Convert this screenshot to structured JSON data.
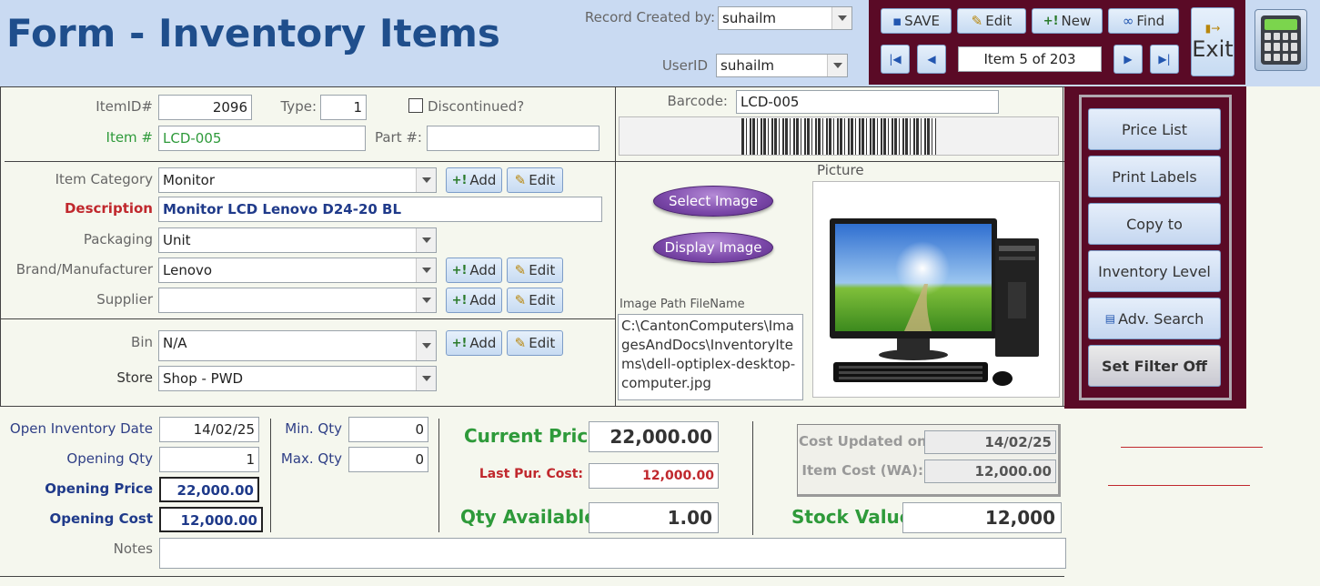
{
  "header": {
    "title": "Form - Inventory Items",
    "created_by_label": "Record Created by:",
    "created_by_value": "suhailm",
    "userid_label": "UserID",
    "userid_value": "suhailm"
  },
  "toolbar": {
    "save": "SAVE",
    "edit": "Edit",
    "new": "New",
    "find": "Find",
    "exit": "Exit",
    "record_indicator": "Item 5 of 203"
  },
  "form": {
    "itemid_label": "ItemID#",
    "itemid_value": "2096",
    "type_label": "Type:",
    "type_value": "1",
    "discontinued_label": "Discontinued?",
    "itemnum_label": "Item #",
    "itemnum_value": "LCD-005",
    "partnum_label": "Part #:",
    "partnum_value": "",
    "barcode_label": "Barcode:",
    "barcode_value": "LCD-005",
    "category_label": "Item Category",
    "category_value": "Monitor",
    "description_label": "Description",
    "description_value": "Monitor LCD Lenovo D24-20 BL",
    "packaging_label": "Packaging",
    "packaging_value": "Unit",
    "brand_label": "Brand/Manufacturer",
    "brand_value": "Lenovo",
    "supplier_label": "Supplier",
    "supplier_value": "",
    "bin_label": "Bin",
    "bin_value": "N/A",
    "store_label": "Store",
    "store_value": "Shop - PWD",
    "add_label": "Add",
    "edit_label": "Edit",
    "picture_label": "Picture",
    "select_image": "Select Image",
    "display_image": "Display Image",
    "image_path_label": "Image Path  FileName",
    "image_path_value": "C:\\CantonComputers\\ImagesAndDocs\\InventoryItems\\dell-optiplex-desktop-computer.jpg"
  },
  "side_buttons": {
    "price_list": "Price List",
    "print_labels": "Print Labels",
    "copy_to": "Copy to",
    "inventory_level": "Inventory Level",
    "adv_search": "Adv. Search",
    "filter_off": "Set Filter Off"
  },
  "stock": {
    "open_date_label": "Open Inventory Date",
    "open_date_value": "14/02/25",
    "opening_qty_label": "Opening Qty",
    "opening_qty_value": "1",
    "opening_price_label": "Opening Price",
    "opening_price_value": "22,000.00",
    "opening_cost_label": "Opening Cost",
    "opening_cost_value": "12,000.00",
    "min_qty_label": "Min. Qty",
    "min_qty_value": "0",
    "max_qty_label": "Max. Qty",
    "max_qty_value": "0",
    "current_price_label": "Current Price:",
    "current_price_value": "22,000.00",
    "last_pur_cost_label": "Last Pur. Cost:",
    "last_pur_cost_value": "12,000.00",
    "qty_available_label": "Qty Available:",
    "qty_available_value": "1.00",
    "stock_value_label": "Stock Value:",
    "stock_value_value": "12,000",
    "cost_updated_label": "Cost Updated on:",
    "cost_updated_value": "14/02/25",
    "item_cost_label": "Item Cost (WA):",
    "item_cost_value": "12,000.00",
    "notes_label": "Notes",
    "notes_value": ""
  },
  "colors": {
    "header_bg": "#c9daf2",
    "title": "#1f4e8c",
    "toolbar_bg": "#5a0a26",
    "green": "#2e9a3a",
    "red": "#c0282d"
  }
}
